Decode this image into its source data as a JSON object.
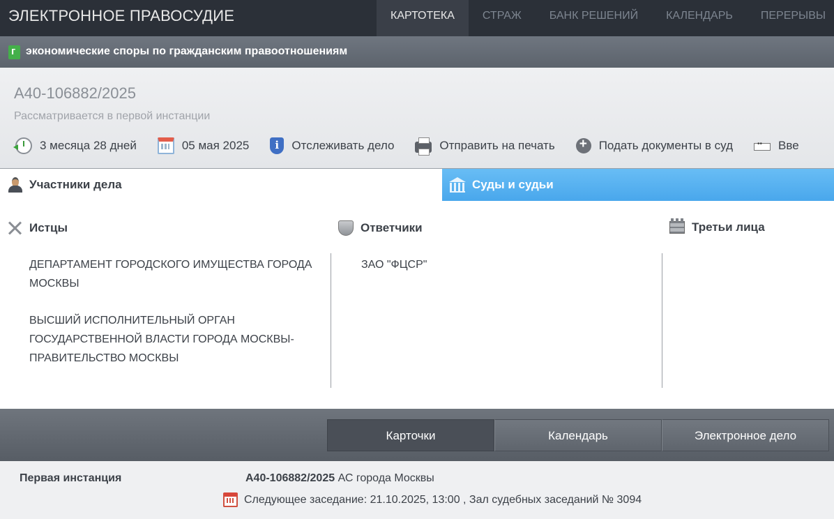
{
  "header": {
    "brand": "ЭЛЕКТРОННОЕ ПРАВОСУДИЕ",
    "nav": [
      "КАРТОТЕКА",
      "СТРАЖ",
      "БАНК РЕШЕНИЙ",
      "КАЛЕНДАРЬ",
      "ПЕРЕРЫВЫ"
    ],
    "active_nav": "КАРТОТЕКА"
  },
  "category": {
    "title": "экономические споры по гражданским правоотношениям"
  },
  "case": {
    "number": "А40-106882/2025",
    "status": "Рассматривается в первой инстанции",
    "actions": [
      {
        "icon": "clock-back-icon",
        "label": "3 месяца 28 дней"
      },
      {
        "icon": "calendar-icon",
        "label": "05 мая 2025"
      },
      {
        "icon": "shield-info-icon",
        "label": "Отслеживать дело"
      },
      {
        "icon": "printer-icon",
        "label": "Отправить на печать"
      },
      {
        "icon": "plus-circle-icon",
        "label": "Подать документы в суд"
      },
      {
        "icon": "video-icon",
        "label": "Вве"
      }
    ]
  },
  "tabs": {
    "participants": "Участники дела",
    "courts": "Суды и судьи"
  },
  "participants": {
    "plaintiffs_title": "Истцы",
    "defendants_title": "Ответчики",
    "third_title": "Третьи лица",
    "plaintiffs": [
      "ДЕПАРТАМЕНТ ГОРОДСКОГО ИМУЩЕСТВА ГОРОДА МОСКВЫ",
      "ВЫСШИЙ ИСПОЛНИТЕЛЬНЫЙ ОРГАН ГОСУДАРСТВЕННОЙ ВЛАСТИ ГОРОДА МОСКВЫ-ПРАВИТЕЛЬСТВО МОСКВЫ"
    ],
    "defendants": [
      "ЗАО \"ФЦСР\""
    ],
    "third_parties": []
  },
  "bottom_nav": {
    "buttons": [
      "Карточки",
      "Календарь",
      "Электронное дело"
    ],
    "active": "Карточки"
  },
  "instance": {
    "label": "Первая инстанция",
    "case_number": "А40-106882/2025",
    "court": "АС города Москвы",
    "next_hearing": "Следующее заседание: 21.10.2025, 13:00 , Зал судебных заседаний № 3094"
  }
}
